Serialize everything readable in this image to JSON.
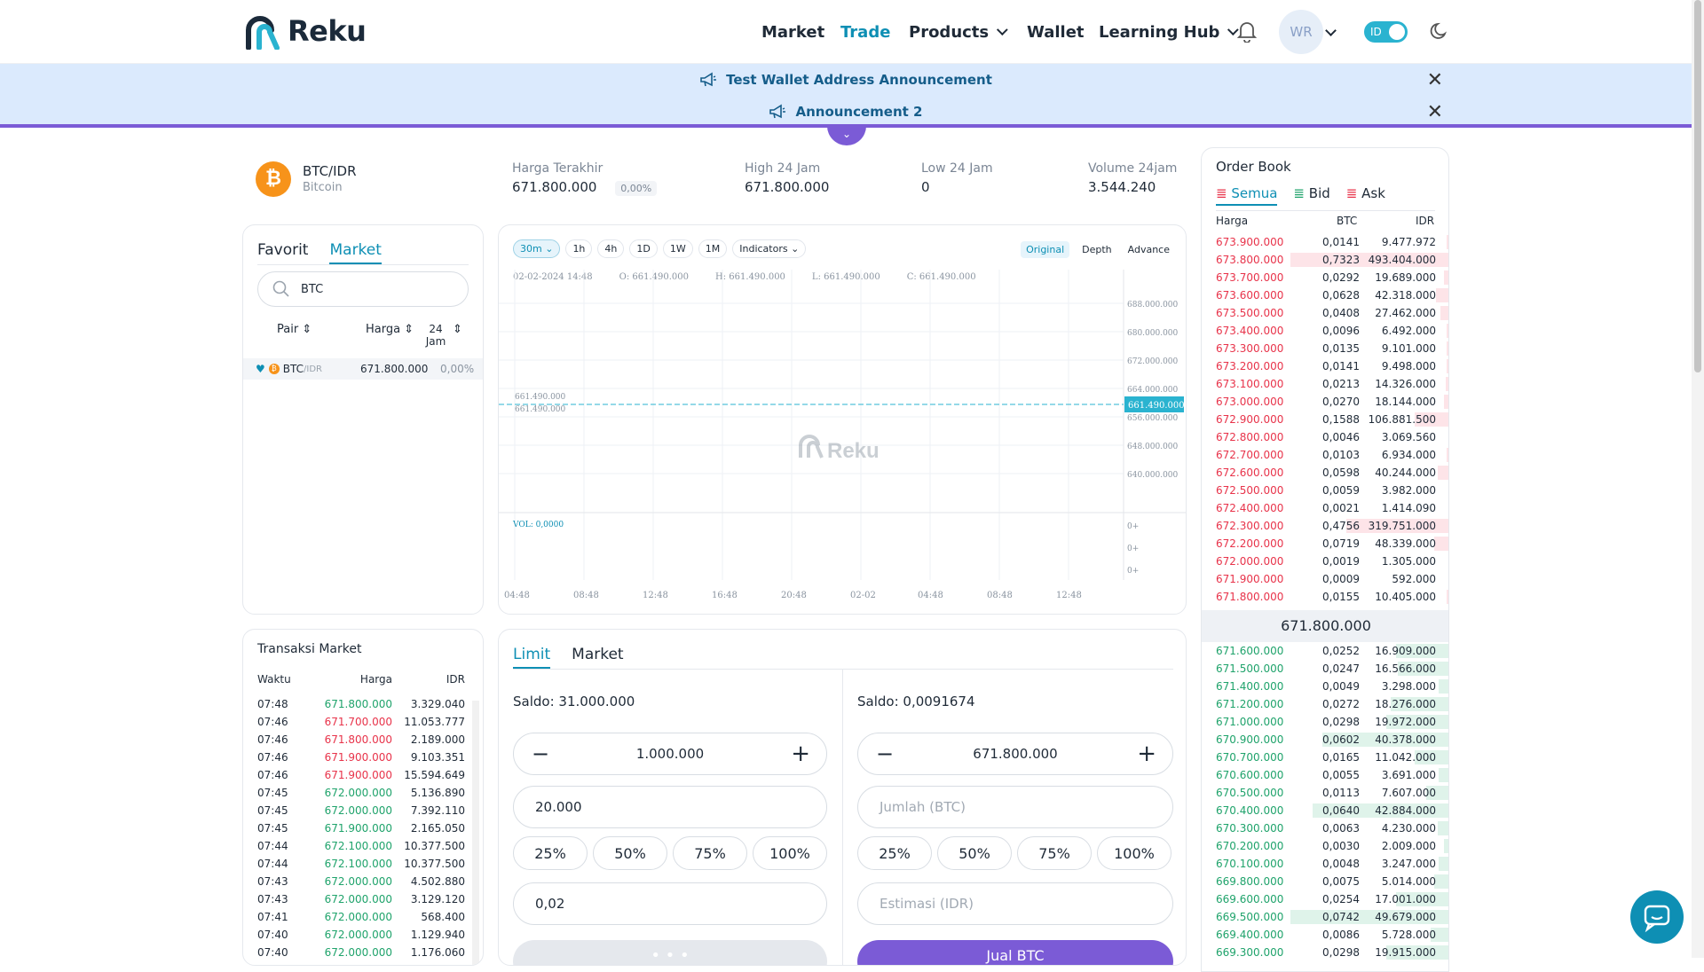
{
  "brand": {
    "name": "Reku"
  },
  "nav": {
    "market": "Market",
    "trade": "Trade",
    "products": "Products",
    "wallet": "Wallet",
    "learning": "Learning Hub"
  },
  "user": {
    "initials": "WR",
    "lang": "ID"
  },
  "colors": {
    "accent": "#0e8fb4",
    "ask": "#e8334a",
    "bid": "#1fa36b",
    "purple": "#7b5bd6"
  },
  "announcements": [
    "Test Wallet Address Announcement",
    "Announcement 2"
  ],
  "ticker": {
    "pair": "BTC/IDR",
    "coin": "Bitcoin",
    "last_label": "Harga Terakhir",
    "last": "671.800.000",
    "change": "0,00%",
    "high_label": "High 24 Jam",
    "high": "671.800.000",
    "low_label": "Low 24 Jam",
    "low": "0",
    "vol_label": "Volume 24jam",
    "vol": "3.544.240"
  },
  "market_panel": {
    "tab_fav": "Favorit",
    "tab_market": "Market",
    "search_value": "BTC",
    "col_pair": "Pair",
    "col_price": "Harga",
    "col_24h": "24\nJam",
    "row": {
      "pair": "BTC",
      "quote": "/IDR",
      "price": "671.800.000",
      "change": "0,00%"
    }
  },
  "chart": {
    "intervals": [
      "30m",
      "1h",
      "4h",
      "1D",
      "1W",
      "1M"
    ],
    "indicators": "Indicators",
    "modes": [
      "Original",
      "Depth",
      "Advance"
    ],
    "ohlc_date": "02-02-2024 14:48",
    "o": "O: 661.490.000",
    "h": "H: 661.490.000",
    "l": "L: 661.490.000",
    "c": "C: 661.490.000",
    "y_ticks": [
      "688.000.000",
      "680.000.000",
      "672.000.000",
      "664.000.000",
      "656.000.000",
      "648.000.000",
      "640.000.000"
    ],
    "price_tag": "661.490.000",
    "left_tag1": "661.490.000",
    "left_tag2": "661.490.000",
    "vol": "VOL: 0,0000",
    "vol_ticks": [
      "0+",
      "0+",
      "0+"
    ],
    "x_ticks": [
      "04:48",
      "08:48",
      "12:48",
      "16:48",
      "20:48",
      "02-02",
      "04:48",
      "08:48",
      "12:48"
    ],
    "watermark": "Reku"
  },
  "trades": {
    "title": "Transaksi Market",
    "col_time": "Waktu",
    "col_price": "Harga",
    "col_idr": "IDR",
    "rows": [
      {
        "t": "07:48",
        "p": "671.800.000",
        "i": "3.329.040",
        "side": "buy"
      },
      {
        "t": "07:46",
        "p": "671.700.000",
        "i": "11.053.777",
        "side": "sell"
      },
      {
        "t": "07:46",
        "p": "671.800.000",
        "i": "2.189.000",
        "side": "sell"
      },
      {
        "t": "07:46",
        "p": "671.900.000",
        "i": "9.103.351",
        "side": "sell"
      },
      {
        "t": "07:46",
        "p": "671.900.000",
        "i": "15.594.649",
        "side": "sell"
      },
      {
        "t": "07:45",
        "p": "672.000.000",
        "i": "5.136.890",
        "side": "buy"
      },
      {
        "t": "07:45",
        "p": "672.000.000",
        "i": "7.392.110",
        "side": "buy"
      },
      {
        "t": "07:45",
        "p": "671.900.000",
        "i": "2.165.050",
        "side": "buy"
      },
      {
        "t": "07:44",
        "p": "672.100.000",
        "i": "10.377.500",
        "side": "buy"
      },
      {
        "t": "07:44",
        "p": "672.100.000",
        "i": "10.377.500",
        "side": "buy"
      },
      {
        "t": "07:43",
        "p": "672.000.000",
        "i": "4.502.880",
        "side": "buy"
      },
      {
        "t": "07:43",
        "p": "672.000.000",
        "i": "3.129.120",
        "side": "buy"
      },
      {
        "t": "07:41",
        "p": "672.000.000",
        "i": "568.400",
        "side": "buy"
      },
      {
        "t": "07:40",
        "p": "672.000.000",
        "i": "1.129.940",
        "side": "buy"
      },
      {
        "t": "07:40",
        "p": "672.000.000",
        "i": "1.176.060",
        "side": "buy"
      }
    ]
  },
  "order": {
    "tab_limit": "Limit",
    "tab_market": "Market",
    "buy": {
      "saldo": "Saldo: 31.000.000",
      "price": "1.000.000",
      "amount": "20.000",
      "pcts": [
        "25%",
        "50%",
        "75%",
        "100%"
      ],
      "total": "0,02",
      "button": "• • •"
    },
    "sell": {
      "saldo": "Saldo: 0,0091674",
      "price": "671.800.000",
      "amount_ph": "Jumlah (BTC)",
      "pcts": [
        "25%",
        "50%",
        "75%",
        "100%"
      ],
      "total_ph": "Estimasi (IDR)",
      "button": "Jual BTC"
    }
  },
  "orderbook": {
    "title": "Order Book",
    "tab_all": "Semua",
    "tab_bid": "Bid",
    "tab_ask": "Ask",
    "col_price": "Harga",
    "col_btc": "BTC",
    "col_idr": "IDR",
    "mid": "671.800.000",
    "asks": [
      {
        "p": "673.900.000",
        "b": "0,0141",
        "i": "9.477.972",
        "d": 0.02
      },
      {
        "p": "673.800.000",
        "b": "0,7323",
        "i": "493.404.000",
        "d": 1.0
      },
      {
        "p": "673.700.000",
        "b": "0,0292",
        "i": "19.689.000",
        "d": 0.04
      },
      {
        "p": "673.600.000",
        "b": "0,0628",
        "i": "42.318.000",
        "d": 0.09
      },
      {
        "p": "673.500.000",
        "b": "0,0408",
        "i": "27.462.000",
        "d": 0.06
      },
      {
        "p": "673.400.000",
        "b": "0,0096",
        "i": "6.492.000",
        "d": 0.02
      },
      {
        "p": "673.300.000",
        "b": "0,0135",
        "i": "9.101.000",
        "d": 0.02
      },
      {
        "p": "673.200.000",
        "b": "0,0141",
        "i": "9.498.000",
        "d": 0.02
      },
      {
        "p": "673.100.000",
        "b": "0,0213",
        "i": "14.326.000",
        "d": 0.03
      },
      {
        "p": "673.000.000",
        "b": "0,0270",
        "i": "18.144.000",
        "d": 0.04
      },
      {
        "p": "672.900.000",
        "b": "0,1588",
        "i": "106.881.500",
        "d": 0.22
      },
      {
        "p": "672.800.000",
        "b": "0,0046",
        "i": "3.069.560",
        "d": 0.01
      },
      {
        "p": "672.700.000",
        "b": "0,0103",
        "i": "6.934.000",
        "d": 0.02
      },
      {
        "p": "672.600.000",
        "b": "0,0598",
        "i": "40.244.000",
        "d": 0.08
      },
      {
        "p": "672.500.000",
        "b": "0,0059",
        "i": "3.982.000",
        "d": 0.01
      },
      {
        "p": "672.400.000",
        "b": "0,0021",
        "i": "1.414.090",
        "d": 0.01
      },
      {
        "p": "672.300.000",
        "b": "0,4756",
        "i": "319.751.000",
        "d": 0.65
      },
      {
        "p": "672.200.000",
        "b": "0,0719",
        "i": "48.339.000",
        "d": 0.1
      },
      {
        "p": "672.000.000",
        "b": "0,0019",
        "i": "1.305.000",
        "d": 0.01
      },
      {
        "p": "671.900.000",
        "b": "0,0009",
        "i": "592.000",
        "d": 0.01
      },
      {
        "p": "671.800.000",
        "b": "0,0155",
        "i": "10.405.000",
        "d": 0.02
      }
    ],
    "bids": [
      {
        "p": "671.600.000",
        "b": "0,0252",
        "i": "16.909.000",
        "d": 0.34
      },
      {
        "p": "671.500.000",
        "b": "0,0247",
        "i": "16.566.000",
        "d": 0.33
      },
      {
        "p": "671.400.000",
        "b": "0,0049",
        "i": "3.298.000",
        "d": 0.07
      },
      {
        "p": "671.200.000",
        "b": "0,0272",
        "i": "18.276.000",
        "d": 0.37
      },
      {
        "p": "671.000.000",
        "b": "0,0298",
        "i": "19.972.000",
        "d": 0.4
      },
      {
        "p": "670.900.000",
        "b": "0,0602",
        "i": "40.378.000",
        "d": 0.8
      },
      {
        "p": "670.700.000",
        "b": "0,0165",
        "i": "11.042.000",
        "d": 0.22
      },
      {
        "p": "670.600.000",
        "b": "0,0055",
        "i": "3.691.000",
        "d": 0.07
      },
      {
        "p": "670.500.000",
        "b": "0,0113",
        "i": "7.607.000",
        "d": 0.15
      },
      {
        "p": "670.400.000",
        "b": "0,0640",
        "i": "42.884.000",
        "d": 0.86
      },
      {
        "p": "670.300.000",
        "b": "0,0063",
        "i": "4.230.000",
        "d": 0.08
      },
      {
        "p": "670.200.000",
        "b": "0,0030",
        "i": "2.009.000",
        "d": 0.04
      },
      {
        "p": "670.100.000",
        "b": "0,0048",
        "i": "3.247.000",
        "d": 0.07
      },
      {
        "p": "669.800.000",
        "b": "0,0075",
        "i": "5.014.000",
        "d": 0.1
      },
      {
        "p": "669.600.000",
        "b": "0,0254",
        "i": "17.001.000",
        "d": 0.34
      },
      {
        "p": "669.500.000",
        "b": "0,0742",
        "i": "49.679.000",
        "d": 1.0
      },
      {
        "p": "669.400.000",
        "b": "0,0086",
        "i": "5.728.000",
        "d": 0.12
      },
      {
        "p": "669.300.000",
        "b": "0,0298",
        "i": "19.915.000",
        "d": 0.4
      }
    ]
  }
}
